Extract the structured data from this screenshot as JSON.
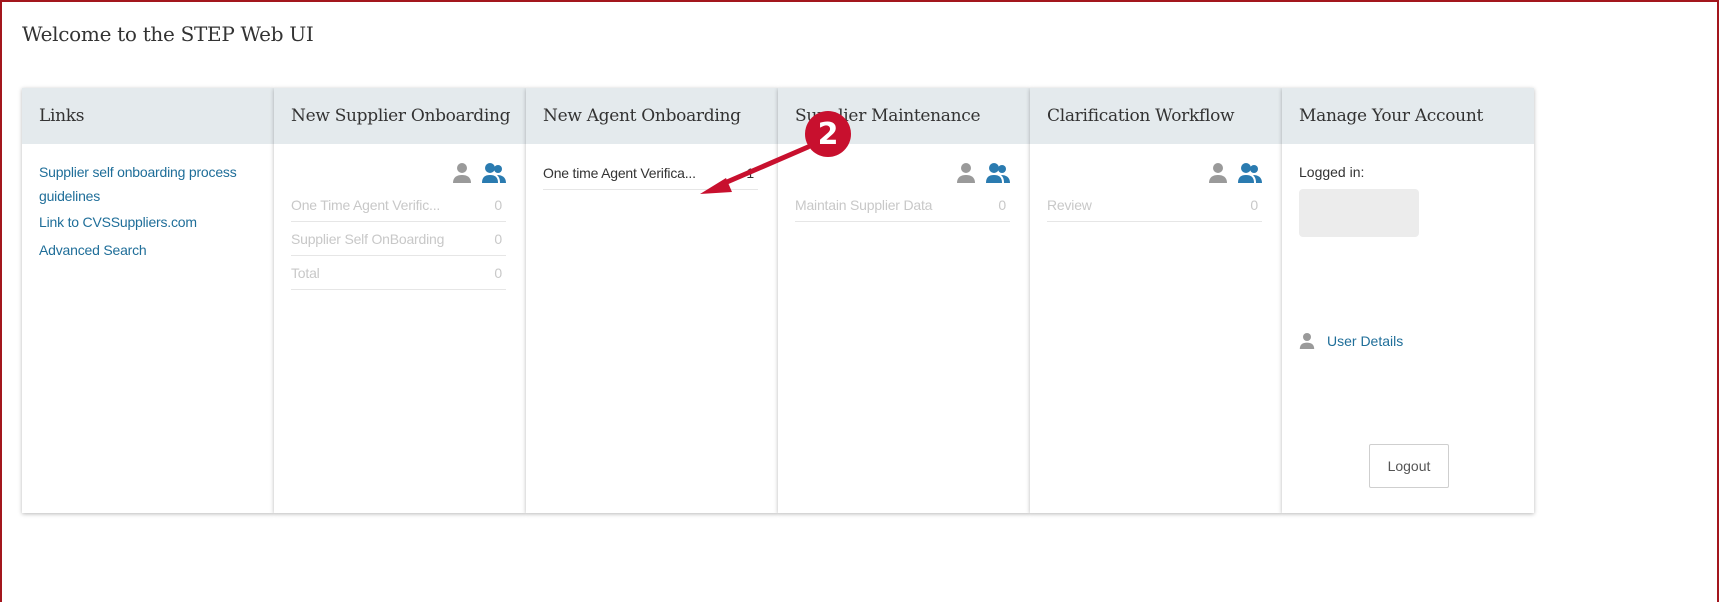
{
  "page": {
    "welcome": "Welcome to the STEP Web UI"
  },
  "cards": {
    "links": {
      "title": "Links",
      "items": [
        "Supplier self onboarding process guidelines",
        "Link to CVSSuppliers.com",
        "Advanced Search"
      ]
    },
    "new_supplier": {
      "title": "New Supplier Onboarding",
      "rows": [
        {
          "label": "One Time Agent Verific...",
          "count": "0"
        },
        {
          "label": "Supplier Self OnBoarding",
          "count": "0"
        },
        {
          "label": "Total",
          "count": "0"
        }
      ]
    },
    "new_agent": {
      "title": "New Agent Onboarding",
      "rows": [
        {
          "label": "One time Agent Verifica...",
          "count": "1"
        }
      ]
    },
    "supplier_maintenance": {
      "title": "Supplier Maintenance",
      "rows": [
        {
          "label": "Maintain Supplier Data",
          "count": "0"
        }
      ]
    },
    "clarification": {
      "title": "Clarification Workflow",
      "rows": [
        {
          "label": "Review",
          "count": "0"
        }
      ]
    },
    "account": {
      "title": "Manage Your Account",
      "logged_in_label": "Logged in:",
      "user_details": "User Details",
      "logout": "Logout"
    }
  },
  "annotation": {
    "marker": "2",
    "color": "#c8102e"
  },
  "colors": {
    "frame_border": "#a3161d",
    "header_bg": "#e4eaed",
    "link": "#1f6e99",
    "icon_blue": "#2a7bb0",
    "icon_gray": "#9a9a9a"
  },
  "icons": [
    "single-user-icon",
    "group-users-icon",
    "user-icon"
  ]
}
